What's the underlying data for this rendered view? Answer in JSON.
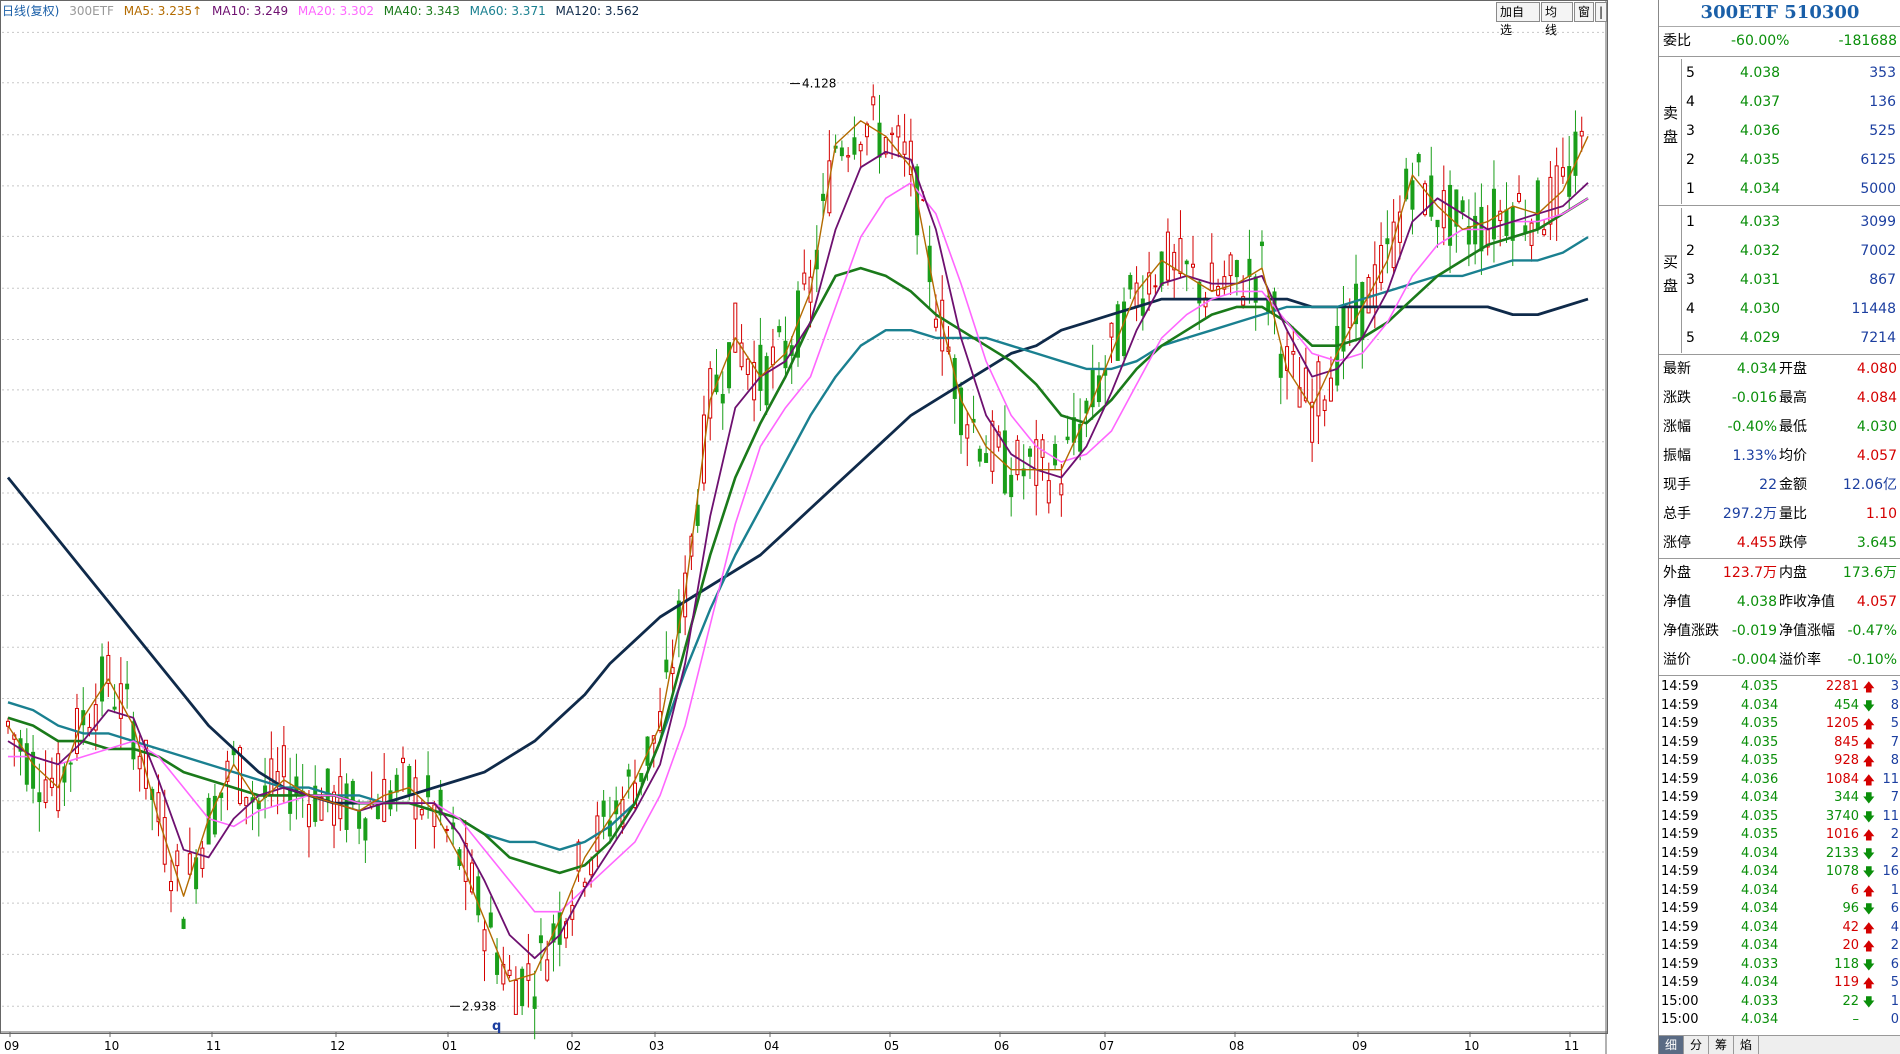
{
  "legend": {
    "period": "日线(复权)",
    "code": "300ETF",
    "ma5": "MA5: 3.235↑",
    "ma10": "MA10: 3.249",
    "ma20": "MA20: 3.302",
    "ma40": "MA40: 3.343",
    "ma60": "MA60: 3.371",
    "ma120": "MA120: 3.562"
  },
  "top_buttons": [
    "加自选",
    "均线",
    "窗",
    "|"
  ],
  "colors": {
    "up": "#d40000",
    "down": "#1a9e1a",
    "ma5": "#b36b00",
    "ma10": "#6e1070",
    "ma20": "#ff66ff",
    "ma40": "#1a7a1a",
    "ma60": "#1a8090",
    "ma120": "#0f2a4a"
  },
  "chart_data": {
    "type": "line",
    "title": "",
    "xlabel": "",
    "ylabel": "",
    "ylim": [
      2.91,
      4.21
    ],
    "y_ticks": [
      "4.194",
      "4.129",
      "4.062",
      "3.996",
      "3.931",
      "3.864",
      "3.798",
      "3.733",
      "3.666",
      "3.600",
      "3.534",
      "3.468",
      "3.401",
      "3.335",
      "3.270",
      "3.203",
      "3.137",
      "3.071",
      "3.005",
      "2.938"
    ],
    "x_ticks": [
      "09",
      "10",
      "11",
      "12",
      "01",
      "02",
      "03",
      "04",
      "05",
      "06",
      "07",
      "08",
      "09",
      "10",
      "11"
    ],
    "x_marker": "q",
    "annotations": [
      {
        "label": "4.128",
        "at_month": "04"
      },
      {
        "label": "2.938",
        "at_month": "01"
      }
    ],
    "series": [
      {
        "name": "MA5",
        "values": [
          3.3,
          3.25,
          3.22,
          3.31,
          3.36,
          3.3,
          3.18,
          3.08,
          3.18,
          3.25,
          3.2,
          3.23,
          3.21,
          3.2,
          3.19,
          3.21,
          3.22,
          3.19,
          3.13,
          3.05,
          2.97,
          2.98,
          3.05,
          3.13,
          3.18,
          3.23,
          3.3,
          3.47,
          3.72,
          3.8,
          3.75,
          3.78,
          3.86,
          4.05,
          4.08,
          4.06,
          4.02,
          3.85,
          3.72,
          3.66,
          3.63,
          3.63,
          3.63,
          3.7,
          3.78,
          3.86,
          3.9,
          3.88,
          3.86,
          3.87,
          3.89,
          3.76,
          3.71,
          3.78,
          3.84,
          3.9,
          4.01,
          3.97,
          3.94,
          3.95,
          3.97,
          3.96,
          3.99,
          4.06
        ]
      },
      {
        "name": "MA10",
        "values": [
          3.28,
          3.26,
          3.25,
          3.28,
          3.32,
          3.31,
          3.23,
          3.14,
          3.13,
          3.18,
          3.21,
          3.22,
          3.21,
          3.2,
          3.19,
          3.2,
          3.2,
          3.2,
          3.16,
          3.1,
          3.03,
          3.0,
          3.03,
          3.09,
          3.14,
          3.19,
          3.25,
          3.38,
          3.57,
          3.71,
          3.75,
          3.77,
          3.82,
          3.94,
          4.02,
          4.04,
          4.03,
          3.94,
          3.8,
          3.7,
          3.65,
          3.63,
          3.62,
          3.66,
          3.73,
          3.81,
          3.87,
          3.88,
          3.87,
          3.87,
          3.88,
          3.81,
          3.75,
          3.76,
          3.8,
          3.86,
          3.95,
          3.98,
          3.96,
          3.94,
          3.95,
          3.96,
          3.97,
          4.0
        ]
      },
      {
        "name": "MA20",
        "values": [
          3.26,
          3.26,
          3.25,
          3.26,
          3.27,
          3.28,
          3.26,
          3.22,
          3.18,
          3.17,
          3.19,
          3.2,
          3.21,
          3.21,
          3.2,
          3.2,
          3.2,
          3.2,
          3.18,
          3.14,
          3.1,
          3.06,
          3.06,
          3.09,
          3.12,
          3.15,
          3.21,
          3.3,
          3.43,
          3.56,
          3.66,
          3.71,
          3.75,
          3.84,
          3.93,
          3.98,
          4.0,
          3.96,
          3.87,
          3.77,
          3.7,
          3.66,
          3.64,
          3.65,
          3.68,
          3.74,
          3.8,
          3.83,
          3.85,
          3.86,
          3.86,
          3.82,
          3.78,
          3.77,
          3.78,
          3.82,
          3.88,
          3.92,
          3.94,
          3.94,
          3.95,
          3.95,
          3.96,
          3.98
        ]
      },
      {
        "name": "MA40",
        "values": [
          3.31,
          3.3,
          3.28,
          3.28,
          3.27,
          3.27,
          3.26,
          3.24,
          3.23,
          3.22,
          3.21,
          3.21,
          3.21,
          3.21,
          3.2,
          3.2,
          3.2,
          3.19,
          3.18,
          3.16,
          3.13,
          3.12,
          3.11,
          3.12,
          3.15,
          3.2,
          3.28,
          3.4,
          3.52,
          3.62,
          3.69,
          3.75,
          3.82,
          3.88,
          3.89,
          3.88,
          3.86,
          3.83,
          3.81,
          3.79,
          3.77,
          3.74,
          3.7,
          3.69,
          3.72,
          3.76,
          3.79,
          3.81,
          3.83,
          3.84,
          3.84,
          3.82,
          3.79,
          3.79,
          3.8,
          3.82,
          3.85,
          3.88,
          3.9,
          3.92,
          3.93,
          3.94,
          3.96,
          3.98
        ]
      },
      {
        "name": "MA60",
        "values": [
          3.33,
          3.32,
          3.3,
          3.29,
          3.29,
          3.28,
          3.27,
          3.26,
          3.25,
          3.24,
          3.23,
          3.22,
          3.22,
          3.21,
          3.21,
          3.2,
          3.2,
          3.19,
          3.18,
          3.16,
          3.15,
          3.15,
          3.14,
          3.15,
          3.17,
          3.2,
          3.28,
          3.37,
          3.45,
          3.52,
          3.58,
          3.64,
          3.7,
          3.75,
          3.79,
          3.81,
          3.81,
          3.8,
          3.8,
          3.8,
          3.79,
          3.78,
          3.77,
          3.76,
          3.76,
          3.77,
          3.79,
          3.8,
          3.81,
          3.82,
          3.83,
          3.84,
          3.84,
          3.84,
          3.85,
          3.86,
          3.87,
          3.88,
          3.88,
          3.89,
          3.9,
          3.9,
          3.91,
          3.93
        ]
      },
      {
        "name": "MA120",
        "values": [
          3.62,
          3.58,
          3.54,
          3.5,
          3.46,
          3.42,
          3.38,
          3.34,
          3.3,
          3.27,
          3.24,
          3.22,
          3.21,
          3.2,
          3.2,
          3.2,
          3.21,
          3.22,
          3.23,
          3.24,
          3.26,
          3.28,
          3.31,
          3.34,
          3.38,
          3.41,
          3.44,
          3.46,
          3.48,
          3.5,
          3.52,
          3.55,
          3.58,
          3.61,
          3.64,
          3.67,
          3.7,
          3.72,
          3.74,
          3.76,
          3.78,
          3.79,
          3.81,
          3.82,
          3.83,
          3.84,
          3.85,
          3.85,
          3.85,
          3.85,
          3.85,
          3.85,
          3.84,
          3.84,
          3.84,
          3.84,
          3.84,
          3.84,
          3.84,
          3.84,
          3.83,
          3.83,
          3.84,
          3.85
        ]
      }
    ]
  },
  "panel": {
    "title": "300ETF 510300",
    "weibi": {
      "label": "委比",
      "pct": "-60.00%",
      "diff": "-181688"
    },
    "sell_label": [
      "卖",
      "盘"
    ],
    "buy_label": [
      "买",
      "盘"
    ],
    "asks": [
      {
        "lv": "5",
        "price": "4.038",
        "vol": "353"
      },
      {
        "lv": "4",
        "price": "4.037",
        "vol": "136"
      },
      {
        "lv": "3",
        "price": "4.036",
        "vol": "525"
      },
      {
        "lv": "2",
        "price": "4.035",
        "vol": "6125"
      },
      {
        "lv": "1",
        "price": "4.034",
        "vol": "5000"
      }
    ],
    "bids": [
      {
        "lv": "1",
        "price": "4.033",
        "vol": "3099"
      },
      {
        "lv": "2",
        "price": "4.032",
        "vol": "7002"
      },
      {
        "lv": "3",
        "price": "4.031",
        "vol": "867"
      },
      {
        "lv": "4",
        "price": "4.030",
        "vol": "11448"
      },
      {
        "lv": "5",
        "price": "4.029",
        "vol": "7214"
      }
    ],
    "stats1": [
      {
        "l1": "最新",
        "v1": "4.034",
        "l2": "开盘",
        "v2": "4.080",
        "c1": "g",
        "c2": "r"
      },
      {
        "l1": "涨跌",
        "v1": "-0.016",
        "l2": "最高",
        "v2": "4.084",
        "c1": "g",
        "c2": "r"
      },
      {
        "l1": "涨幅",
        "v1": "-0.40%",
        "l2": "最低",
        "v2": "4.030",
        "c1": "g",
        "c2": "g"
      },
      {
        "l1": "振幅",
        "v1": "1.33%",
        "l2": "均价",
        "v2": "4.057",
        "c1": "bl",
        "c2": "r"
      },
      {
        "l1": "现手",
        "v1": "22",
        "l2": "金额",
        "v2": "12.06亿",
        "c1": "bl",
        "c2": "bl"
      },
      {
        "l1": "总手",
        "v1": "297.2万",
        "l2": "量比",
        "v2": "1.10",
        "c1": "bl",
        "c2": "r"
      },
      {
        "l1": "涨停",
        "v1": "4.455",
        "l2": "跌停",
        "v2": "3.645",
        "c1": "r",
        "c2": "g"
      }
    ],
    "stats2": [
      {
        "l1": "外盘",
        "v1": "123.7万",
        "l2": "内盘",
        "v2": "173.6万",
        "c1": "r",
        "c2": "g"
      },
      {
        "l1": "净值",
        "v1": "4.038",
        "l2": "昨收净值",
        "v2": "4.057",
        "c1": "g",
        "c2": "r"
      },
      {
        "l1": "净值涨跌",
        "v1": "-0.019",
        "l2": "净值涨幅",
        "v2": "-0.47%",
        "c1": "g",
        "c2": "g"
      },
      {
        "l1": "溢价",
        "v1": "-0.004",
        "l2": "溢价率",
        "v2": "-0.10%",
        "c1": "g",
        "c2": "g"
      }
    ],
    "ticks": [
      {
        "t": "14:59",
        "p": "4.035",
        "v": "2281",
        "d": "up",
        "n": "3"
      },
      {
        "t": "14:59",
        "p": "4.034",
        "v": "454",
        "d": "down",
        "n": "8"
      },
      {
        "t": "14:59",
        "p": "4.035",
        "v": "1205",
        "d": "up",
        "n": "5"
      },
      {
        "t": "14:59",
        "p": "4.035",
        "v": "845",
        "d": "up",
        "n": "7"
      },
      {
        "t": "14:59",
        "p": "4.035",
        "v": "928",
        "d": "up",
        "n": "8"
      },
      {
        "t": "14:59",
        "p": "4.036",
        "v": "1084",
        "d": "up",
        "n": "11"
      },
      {
        "t": "14:59",
        "p": "4.034",
        "v": "344",
        "d": "down",
        "n": "7"
      },
      {
        "t": "14:59",
        "p": "4.035",
        "v": "3740",
        "d": "down",
        "n": "11"
      },
      {
        "t": "14:59",
        "p": "4.035",
        "v": "1016",
        "d": "up",
        "n": "2"
      },
      {
        "t": "14:59",
        "p": "4.034",
        "v": "2133",
        "d": "down",
        "n": "2"
      },
      {
        "t": "14:59",
        "p": "4.034",
        "v": "1078",
        "d": "down",
        "n": "16"
      },
      {
        "t": "14:59",
        "p": "4.034",
        "v": "6",
        "d": "up",
        "n": "1"
      },
      {
        "t": "14:59",
        "p": "4.034",
        "v": "96",
        "d": "down",
        "n": "6"
      },
      {
        "t": "14:59",
        "p": "4.034",
        "v": "42",
        "d": "up",
        "n": "4"
      },
      {
        "t": "14:59",
        "p": "4.034",
        "v": "20",
        "d": "up",
        "n": "2"
      },
      {
        "t": "14:59",
        "p": "4.033",
        "v": "118",
        "d": "down",
        "n": "6"
      },
      {
        "t": "14:59",
        "p": "4.034",
        "v": "119",
        "d": "up",
        "n": "5"
      },
      {
        "t": "15:00",
        "p": "4.033",
        "v": "22",
        "d": "down",
        "n": "1"
      },
      {
        "t": "15:00",
        "p": "4.034",
        "v": "–",
        "d": "none",
        "n": "0"
      }
    ],
    "tabs": [
      "细",
      "分",
      "筹",
      "焰"
    ]
  }
}
